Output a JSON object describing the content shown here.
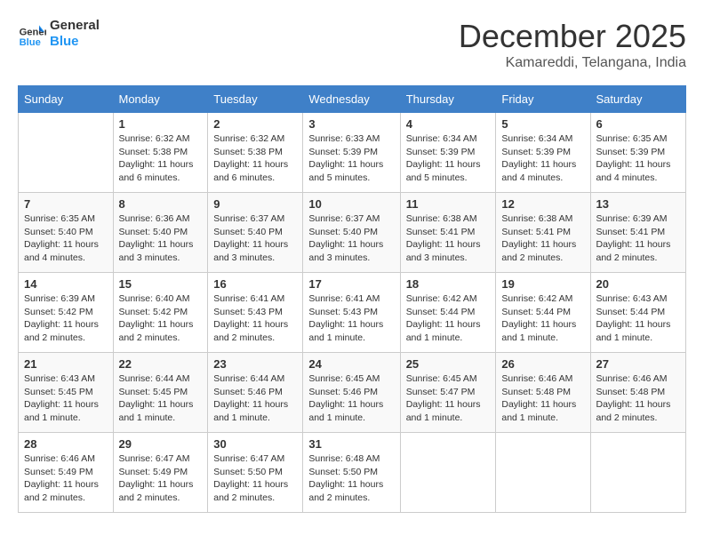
{
  "header": {
    "logo_line1": "General",
    "logo_line2": "Blue",
    "month": "December 2025",
    "location": "Kamareddi, Telangana, India"
  },
  "weekdays": [
    "Sunday",
    "Monday",
    "Tuesday",
    "Wednesday",
    "Thursday",
    "Friday",
    "Saturday"
  ],
  "weeks": [
    [
      {
        "day": "",
        "sunrise": "",
        "sunset": "",
        "daylight": ""
      },
      {
        "day": "1",
        "sunrise": "Sunrise: 6:32 AM",
        "sunset": "Sunset: 5:38 PM",
        "daylight": "Daylight: 11 hours and 6 minutes."
      },
      {
        "day": "2",
        "sunrise": "Sunrise: 6:32 AM",
        "sunset": "Sunset: 5:38 PM",
        "daylight": "Daylight: 11 hours and 6 minutes."
      },
      {
        "day": "3",
        "sunrise": "Sunrise: 6:33 AM",
        "sunset": "Sunset: 5:39 PM",
        "daylight": "Daylight: 11 hours and 5 minutes."
      },
      {
        "day": "4",
        "sunrise": "Sunrise: 6:34 AM",
        "sunset": "Sunset: 5:39 PM",
        "daylight": "Daylight: 11 hours and 5 minutes."
      },
      {
        "day": "5",
        "sunrise": "Sunrise: 6:34 AM",
        "sunset": "Sunset: 5:39 PM",
        "daylight": "Daylight: 11 hours and 4 minutes."
      },
      {
        "day": "6",
        "sunrise": "Sunrise: 6:35 AM",
        "sunset": "Sunset: 5:39 PM",
        "daylight": "Daylight: 11 hours and 4 minutes."
      }
    ],
    [
      {
        "day": "7",
        "sunrise": "Sunrise: 6:35 AM",
        "sunset": "Sunset: 5:40 PM",
        "daylight": "Daylight: 11 hours and 4 minutes."
      },
      {
        "day": "8",
        "sunrise": "Sunrise: 6:36 AM",
        "sunset": "Sunset: 5:40 PM",
        "daylight": "Daylight: 11 hours and 3 minutes."
      },
      {
        "day": "9",
        "sunrise": "Sunrise: 6:37 AM",
        "sunset": "Sunset: 5:40 PM",
        "daylight": "Daylight: 11 hours and 3 minutes."
      },
      {
        "day": "10",
        "sunrise": "Sunrise: 6:37 AM",
        "sunset": "Sunset: 5:40 PM",
        "daylight": "Daylight: 11 hours and 3 minutes."
      },
      {
        "day": "11",
        "sunrise": "Sunrise: 6:38 AM",
        "sunset": "Sunset: 5:41 PM",
        "daylight": "Daylight: 11 hours and 3 minutes."
      },
      {
        "day": "12",
        "sunrise": "Sunrise: 6:38 AM",
        "sunset": "Sunset: 5:41 PM",
        "daylight": "Daylight: 11 hours and 2 minutes."
      },
      {
        "day": "13",
        "sunrise": "Sunrise: 6:39 AM",
        "sunset": "Sunset: 5:41 PM",
        "daylight": "Daylight: 11 hours and 2 minutes."
      }
    ],
    [
      {
        "day": "14",
        "sunrise": "Sunrise: 6:39 AM",
        "sunset": "Sunset: 5:42 PM",
        "daylight": "Daylight: 11 hours and 2 minutes."
      },
      {
        "day": "15",
        "sunrise": "Sunrise: 6:40 AM",
        "sunset": "Sunset: 5:42 PM",
        "daylight": "Daylight: 11 hours and 2 minutes."
      },
      {
        "day": "16",
        "sunrise": "Sunrise: 6:41 AM",
        "sunset": "Sunset: 5:43 PM",
        "daylight": "Daylight: 11 hours and 2 minutes."
      },
      {
        "day": "17",
        "sunrise": "Sunrise: 6:41 AM",
        "sunset": "Sunset: 5:43 PM",
        "daylight": "Daylight: 11 hours and 1 minute."
      },
      {
        "day": "18",
        "sunrise": "Sunrise: 6:42 AM",
        "sunset": "Sunset: 5:44 PM",
        "daylight": "Daylight: 11 hours and 1 minute."
      },
      {
        "day": "19",
        "sunrise": "Sunrise: 6:42 AM",
        "sunset": "Sunset: 5:44 PM",
        "daylight": "Daylight: 11 hours and 1 minute."
      },
      {
        "day": "20",
        "sunrise": "Sunrise: 6:43 AM",
        "sunset": "Sunset: 5:44 PM",
        "daylight": "Daylight: 11 hours and 1 minute."
      }
    ],
    [
      {
        "day": "21",
        "sunrise": "Sunrise: 6:43 AM",
        "sunset": "Sunset: 5:45 PM",
        "daylight": "Daylight: 11 hours and 1 minute."
      },
      {
        "day": "22",
        "sunrise": "Sunrise: 6:44 AM",
        "sunset": "Sunset: 5:45 PM",
        "daylight": "Daylight: 11 hours and 1 minute."
      },
      {
        "day": "23",
        "sunrise": "Sunrise: 6:44 AM",
        "sunset": "Sunset: 5:46 PM",
        "daylight": "Daylight: 11 hours and 1 minute."
      },
      {
        "day": "24",
        "sunrise": "Sunrise: 6:45 AM",
        "sunset": "Sunset: 5:46 PM",
        "daylight": "Daylight: 11 hours and 1 minute."
      },
      {
        "day": "25",
        "sunrise": "Sunrise: 6:45 AM",
        "sunset": "Sunset: 5:47 PM",
        "daylight": "Daylight: 11 hours and 1 minute."
      },
      {
        "day": "26",
        "sunrise": "Sunrise: 6:46 AM",
        "sunset": "Sunset: 5:48 PM",
        "daylight": "Daylight: 11 hours and 1 minute."
      },
      {
        "day": "27",
        "sunrise": "Sunrise: 6:46 AM",
        "sunset": "Sunset: 5:48 PM",
        "daylight": "Daylight: 11 hours and 2 minutes."
      }
    ],
    [
      {
        "day": "28",
        "sunrise": "Sunrise: 6:46 AM",
        "sunset": "Sunset: 5:49 PM",
        "daylight": "Daylight: 11 hours and 2 minutes."
      },
      {
        "day": "29",
        "sunrise": "Sunrise: 6:47 AM",
        "sunset": "Sunset: 5:49 PM",
        "daylight": "Daylight: 11 hours and 2 minutes."
      },
      {
        "day": "30",
        "sunrise": "Sunrise: 6:47 AM",
        "sunset": "Sunset: 5:50 PM",
        "daylight": "Daylight: 11 hours and 2 minutes."
      },
      {
        "day": "31",
        "sunrise": "Sunrise: 6:48 AM",
        "sunset": "Sunset: 5:50 PM",
        "daylight": "Daylight: 11 hours and 2 minutes."
      },
      {
        "day": "",
        "sunrise": "",
        "sunset": "",
        "daylight": ""
      },
      {
        "day": "",
        "sunrise": "",
        "sunset": "",
        "daylight": ""
      },
      {
        "day": "",
        "sunrise": "",
        "sunset": "",
        "daylight": ""
      }
    ]
  ]
}
